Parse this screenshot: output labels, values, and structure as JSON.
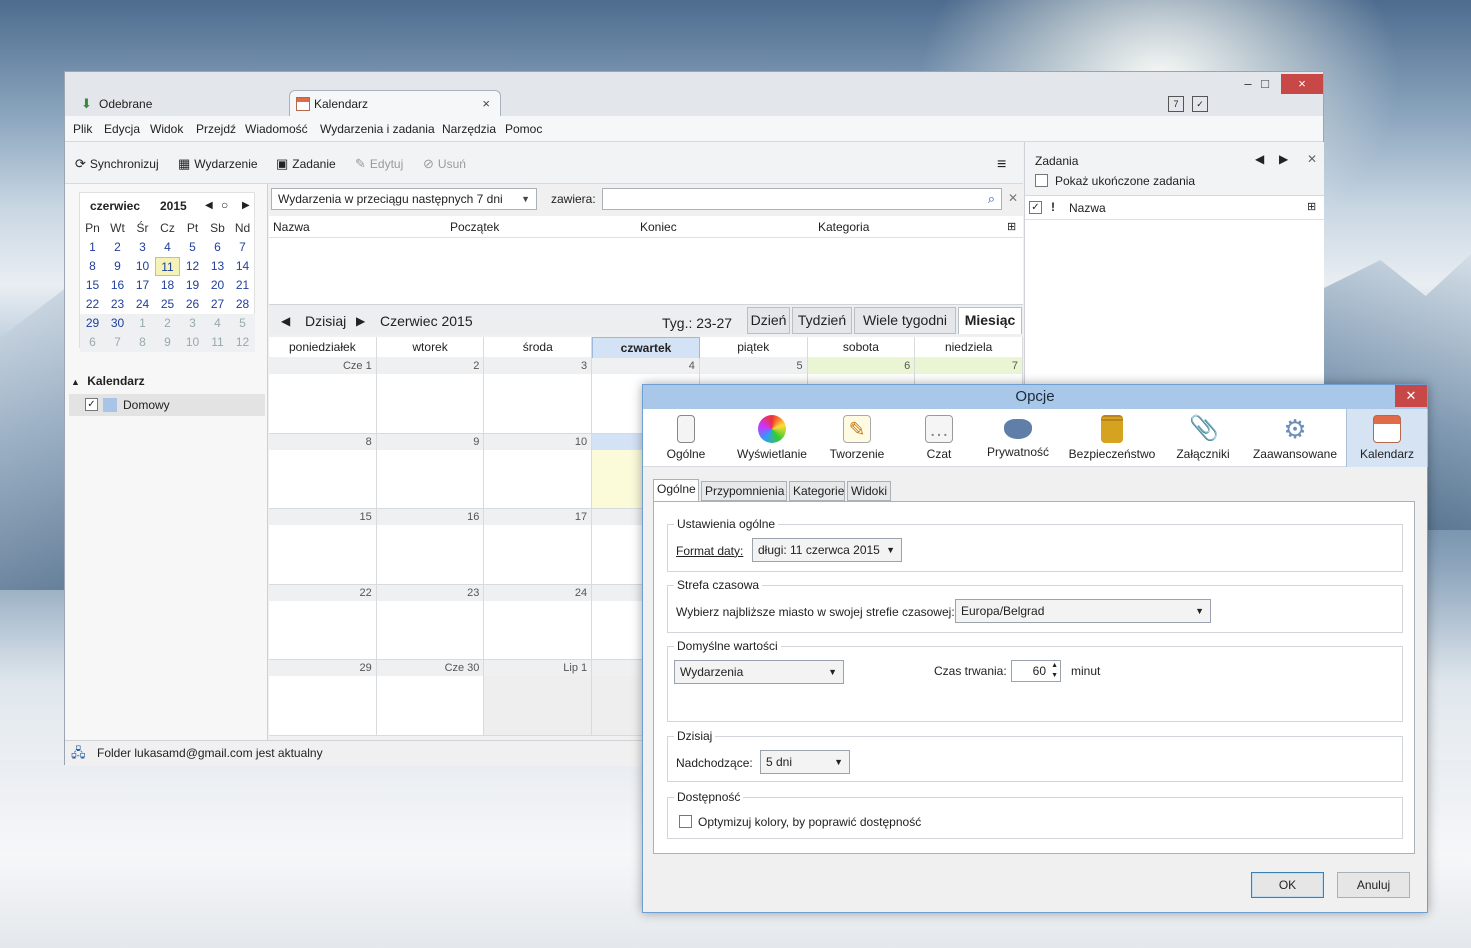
{
  "window": {
    "tabs": [
      {
        "label": "Odebrane"
      },
      {
        "label": "Kalendarz",
        "close": "×"
      }
    ],
    "controls": {
      "minimize": "–",
      "maximize": "□",
      "close": "×"
    }
  },
  "menu": [
    "Plik",
    "Edycja",
    "Widok",
    "Przejdź",
    "Wiadomość",
    "Wydarzenia i zadania",
    "Narzędzia",
    "Pomoc"
  ],
  "toolbar": {
    "sync": "Synchronizuj",
    "event": "Wydarzenie",
    "task": "Zadanie",
    "edit": "Edytuj",
    "delete": "Usuń"
  },
  "minical": {
    "month": "czerwiec",
    "year": "2015",
    "days_of_week": [
      "Pn",
      "Wt",
      "Śr",
      "Cz",
      "Pt",
      "Sb",
      "Nd"
    ],
    "weeks": [
      [
        "1",
        "2",
        "3",
        "4",
        "5",
        "6",
        "7"
      ],
      [
        "8",
        "9",
        "10",
        "11",
        "12",
        "13",
        "14"
      ],
      [
        "15",
        "16",
        "17",
        "18",
        "19",
        "20",
        "21"
      ],
      [
        "22",
        "23",
        "24",
        "25",
        "26",
        "27",
        "28"
      ],
      [
        "29",
        "30",
        "1",
        "2",
        "3",
        "4",
        "5"
      ],
      [
        "6",
        "7",
        "8",
        "9",
        "10",
        "11",
        "12"
      ]
    ],
    "today": "11"
  },
  "calendars": {
    "section": "Kalendarz",
    "items": [
      {
        "name": "Domowy",
        "checked": true,
        "color": "#a8c4e6"
      }
    ]
  },
  "filter": {
    "range": "Wydarzenia w przeciągu następnych 7 dni",
    "contains_label": "zawiera:",
    "search_value": ""
  },
  "list_columns": [
    "Nazwa",
    "Początek",
    "Koniec",
    "Kategoria"
  ],
  "nav": {
    "today": "Dzisiaj",
    "current": "Czerwiec 2015",
    "week_range": "Tyg.: 23-27",
    "views": [
      "Dzień",
      "Tydzień",
      "Wiele tygodni",
      "Miesiąc"
    ],
    "active_view": "Miesiąc"
  },
  "month": {
    "headers": [
      "poniedziałek",
      "wtorek",
      "środa",
      "czwartek",
      "piątek",
      "sobota",
      "niedziela"
    ],
    "rows": [
      [
        "Cze 1",
        "2",
        "3",
        "4",
        "5",
        "6",
        "7"
      ],
      [
        "8",
        "9",
        "10",
        "",
        "",
        "",
        ""
      ],
      [
        "15",
        "16",
        "17",
        "",
        "",
        "",
        ""
      ],
      [
        "22",
        "23",
        "24",
        "",
        "",
        "",
        ""
      ],
      [
        "29",
        "Cze 30",
        "Lip 1",
        "",
        "",
        "",
        ""
      ]
    ]
  },
  "status": "Folder lukasamd@gmail.com jest aktualny",
  "tasks": {
    "title": "Zadania",
    "show_completed": "Pokaż ukończone zadania",
    "column": "Nazwa",
    "priority_col": "!"
  },
  "dialog": {
    "title": "Opcje",
    "prefs": [
      "Ogólne",
      "Wyświetlanie",
      "Tworzenie",
      "Czat",
      "Prywatność",
      "Bezpieczeństwo",
      "Załączniki",
      "Zaawansowane",
      "Kalendarz"
    ],
    "active_pref": "Kalendarz",
    "subtabs": [
      "Ogólne",
      "Przypomnienia",
      "Kategorie",
      "Widoki"
    ],
    "general": {
      "group": "Ustawienia ogólne",
      "date_format_label": "Format daty:",
      "date_format_value": "długi: 11 czerwca 2015"
    },
    "timezone": {
      "group": "Strefa czasowa",
      "label": "Wybierz najbliższe miasto w swojej strefie czasowej:",
      "value": "Europa/Belgrad"
    },
    "defaults": {
      "group": "Domyślne wartości",
      "type_value": "Wydarzenia",
      "duration_label": "Czas trwania:",
      "duration_value": "60",
      "duration_unit": "minut"
    },
    "today": {
      "group": "Dzisiaj",
      "label": "Nadchodzące:",
      "value": "5 dni"
    },
    "accessibility": {
      "group": "Dostępność",
      "label": "Optymizuj kolory, by poprawić dostępność"
    },
    "ok": "OK",
    "cancel": "Anuluj"
  }
}
